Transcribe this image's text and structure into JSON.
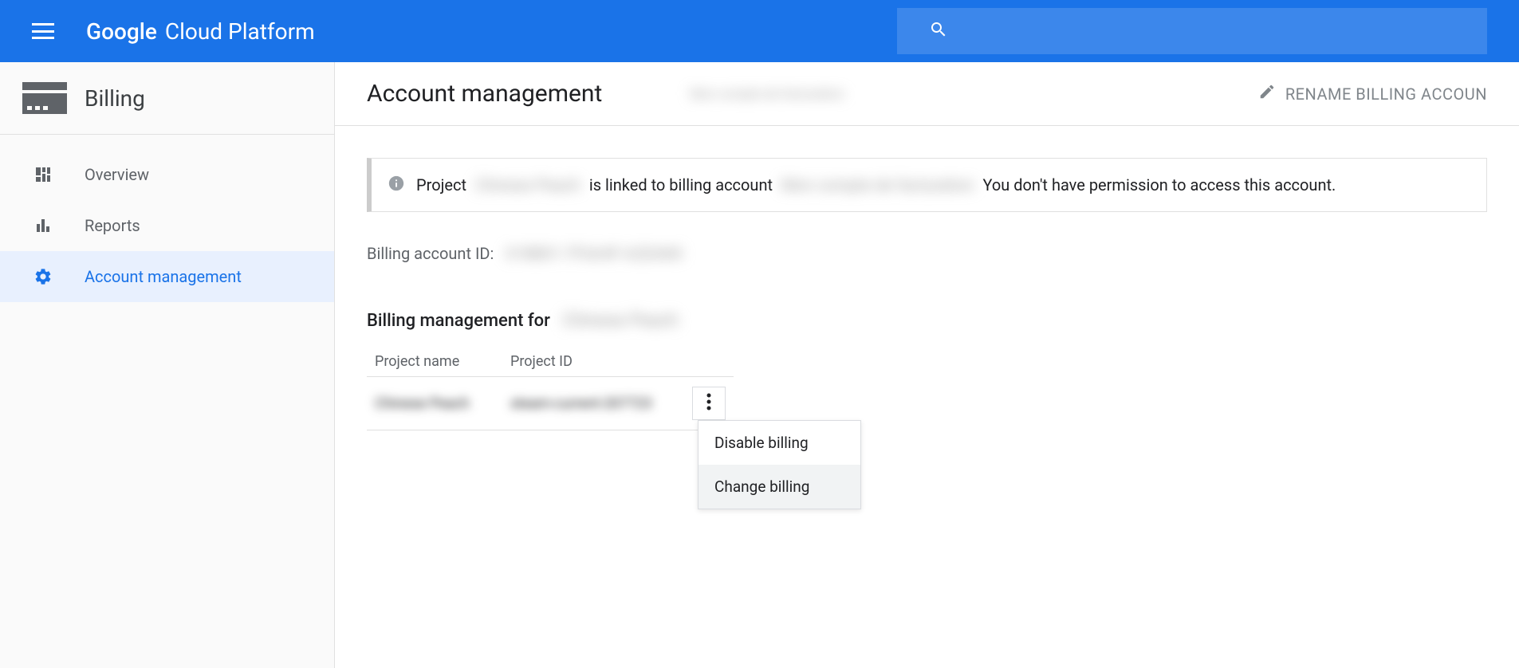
{
  "header": {
    "logo_google": "Google",
    "logo_platform": "Cloud Platform"
  },
  "sidebar": {
    "title": "Billing",
    "items": [
      {
        "label": "Overview"
      },
      {
        "label": "Reports"
      },
      {
        "label": "Account management"
      }
    ]
  },
  "main": {
    "page_title": "Account management",
    "account_name_redacted": "Mon compte de facturation",
    "rename_button": "RENAME BILLING ACCOUN",
    "info_banner": {
      "prefix": "Project",
      "project_redacted": "Chinese Peach",
      "middle": "is linked to billing account",
      "account_redacted": "Mon compte de facturation",
      "suffix": "You don't have permission to access this account."
    },
    "account_id_label": "Billing account ID:",
    "account_id_redacted": "018B01-7F6A4F-A2DA84",
    "section_title": "Billing management for",
    "section_project_redacted": "Chinese Peach",
    "table": {
      "headers": [
        "Project name",
        "Project ID"
      ],
      "row": {
        "project_name_redacted": "Chinese Peach",
        "project_id_redacted": "steam-current-207723"
      }
    },
    "dropdown": {
      "disable": "Disable billing",
      "change": "Change billing"
    }
  }
}
